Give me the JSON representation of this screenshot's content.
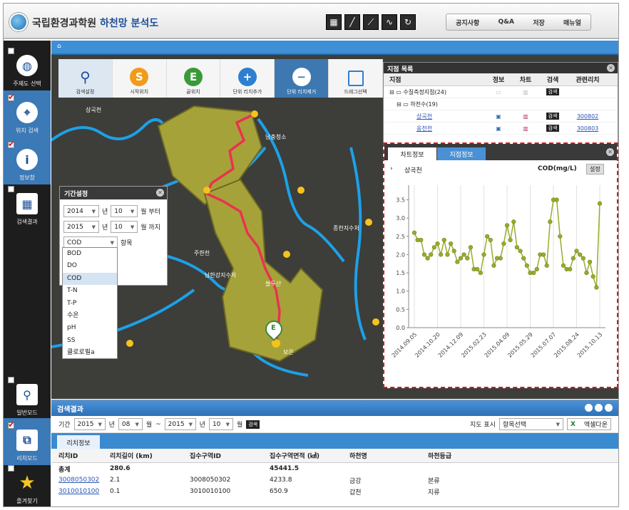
{
  "header": {
    "org": "국립환경과학원",
    "app": "하천망 분석도",
    "menu": [
      "공지사항",
      "Q&A",
      "저장",
      "매뉴얼"
    ],
    "tool_icons": [
      "map-image-icon",
      "line-icon",
      "polyline-icon",
      "curve-icon",
      "refresh-icon"
    ]
  },
  "sidebar": {
    "items": [
      {
        "label": "주제도 선택",
        "checked": false,
        "icon": "globe-icon"
      },
      {
        "label": "위치 검색",
        "checked": true,
        "icon": "location-pin-icon"
      },
      {
        "label": "정보창",
        "checked": true,
        "icon": "info-icon"
      },
      {
        "label": "검색결과",
        "checked": false,
        "icon": "grid-icon"
      },
      {
        "label": "일반모드",
        "checked": false,
        "icon": "magnifier-icon"
      },
      {
        "label": "리치모드",
        "checked": true,
        "icon": "reach-icon"
      },
      {
        "label": "즐겨찾기",
        "checked": false,
        "icon": "star-icon"
      }
    ]
  },
  "map": {
    "tools": [
      "검색설정",
      "시작위치",
      "끝위치",
      "단위 리치추가",
      "단위 리치제거",
      "드래그선택"
    ],
    "tool_letters": [
      "S",
      "E",
      "+",
      "−"
    ],
    "labels": [
      "상곡천",
      "주한천",
      "종천지수처",
      "남충청소",
      "남한강지수처",
      "쌀두산",
      "보은"
    ],
    "marker_e": "E"
  },
  "period": {
    "title": "기간설정",
    "start_year": "2014",
    "year_unit": "년",
    "start_month": "10",
    "from_label": "월 부터",
    "end_year": "2015",
    "end_month": "10",
    "to_label": "월 까지",
    "item": "COD",
    "item_label": "항목",
    "options": [
      "BOD",
      "DO",
      "COD",
      "T-N",
      "T-P",
      "수온",
      "pH",
      "SS",
      "클로로필a"
    ]
  },
  "pointlist": {
    "title": "지점 목록",
    "columns": [
      "지점",
      "정보",
      "차트",
      "검색",
      "관련리치"
    ],
    "rows": [
      {
        "name": "수질측정지점(24)",
        "search": "검색",
        "reach": ""
      },
      {
        "name": "하천수(19)",
        "search": "",
        "reach": ""
      },
      {
        "name": "상곡천",
        "search": "검색",
        "reach": "300802"
      },
      {
        "name": "옹천천",
        "search": "검색",
        "reach": "300803"
      }
    ]
  },
  "chartpanel": {
    "tabs": [
      "차트정보",
      "지점정보"
    ],
    "station": "상곡천",
    "metric": "COD(mg/L)",
    "settings": "설정"
  },
  "chart_data": {
    "type": "line",
    "title": "",
    "xlabel": "",
    "ylabel": "COD(mg/L)",
    "ylim": [
      0,
      3.9
    ],
    "yticks": [
      0,
      0.5,
      1,
      1.5,
      2,
      2.5,
      3,
      3.5
    ],
    "xticks": [
      "2014.09.05",
      "2014.10.20",
      "2014.12.09",
      "2015.02.23",
      "2015.04.09",
      "2015.05.29",
      "2015.07.07",
      "2015.08.24",
      "2015.10.13"
    ],
    "grid": "x",
    "color": "#9aab2c",
    "values": [
      2.6,
      2.4,
      2.4,
      2.0,
      1.9,
      2.0,
      2.2,
      2.3,
      2.0,
      2.4,
      2.0,
      2.3,
      2.1,
      1.8,
      1.9,
      2.0,
      1.9,
      2.2,
      1.6,
      1.6,
      1.5,
      2.0,
      2.5,
      2.4,
      1.7,
      1.9,
      1.9,
      2.3,
      2.8,
      2.4,
      2.9,
      2.2,
      2.1,
      1.9,
      1.7,
      1.5,
      1.5,
      1.6,
      2.0,
      2.0,
      1.7,
      2.9,
      3.5,
      3.5,
      2.5,
      1.7,
      1.6,
      1.6,
      1.9,
      2.1,
      2.0,
      1.9,
      1.5,
      1.8,
      1.4,
      1.1,
      3.4
    ]
  },
  "results": {
    "title": "검색결과",
    "period_label": "기간",
    "start_year": "2015",
    "year_unit": "년",
    "start_month": "08",
    "month_unit": "월",
    "tilde": "~",
    "end_year": "2015",
    "end_month": "10",
    "search": "검색",
    "map_label": "지도 표시",
    "item_select": "항목선택",
    "excel": "엑셀다운",
    "tab": "리치정보",
    "columns": [
      "리치ID",
      "리치길이 (km)",
      "집수구역ID",
      "집수구역면적 (㎢)",
      "하천명",
      "하천등급"
    ],
    "rows": [
      [
        "총계",
        "280.6",
        "",
        "45441.5",
        "",
        ""
      ],
      [
        "3008050302",
        "2.1",
        "3008050302",
        "4233.8",
        "금강",
        "본류"
      ],
      [
        "3010010100",
        "0.1",
        "3010010100",
        "650.9",
        "갑천",
        "지류"
      ]
    ]
  }
}
